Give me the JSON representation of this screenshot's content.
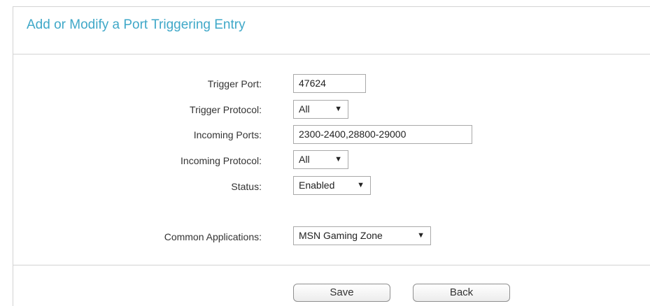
{
  "page": {
    "title": "Add or Modify a Port Triggering Entry"
  },
  "form": {
    "trigger_port": {
      "label": "Trigger Port:",
      "value": "47624"
    },
    "trigger_protocol": {
      "label": "Trigger Protocol:",
      "value": "All"
    },
    "incoming_ports": {
      "label": "Incoming Ports:",
      "value": "2300-2400,28800-29000"
    },
    "incoming_protocol": {
      "label": "Incoming Protocol:",
      "value": "All"
    },
    "status": {
      "label": "Status:",
      "value": "Enabled"
    },
    "common_applications": {
      "label": "Common Applications:",
      "value": "MSN Gaming Zone"
    }
  },
  "buttons": {
    "save": "Save",
    "back": "Back"
  },
  "icons": {
    "dropdown": "▼"
  },
  "colors": {
    "title": "#3fa8c8",
    "divider": "#d3d3d3"
  }
}
